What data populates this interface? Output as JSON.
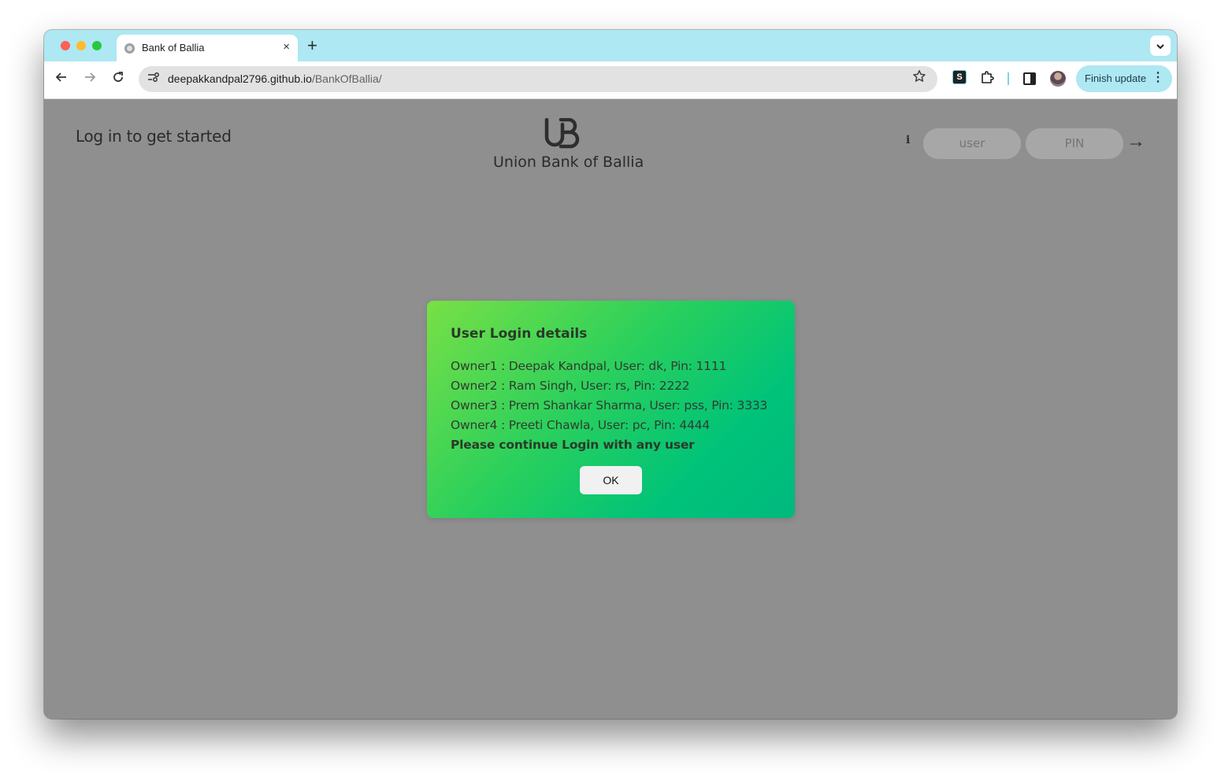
{
  "browser": {
    "tab_title": "Bank of Ballia",
    "tab_close_icon": "×",
    "new_tab_icon": "+",
    "url_host": "deepakkandpal2796.github.io",
    "url_path": "/BankOfBallia/",
    "finish_update_label": "Finish update",
    "extension_s_label": "S"
  },
  "header": {
    "welcome": "Log in to get started",
    "bank_name": "Union Bank of Ballia",
    "info_icon": "i",
    "user_placeholder": "user",
    "pin_placeholder": "PIN",
    "login_arrow": "→"
  },
  "modal": {
    "title": "User Login details",
    "lines": [
      "Owner1 : Deepak Kandpal, User: dk, Pin: 1111",
      "Owner2 : Ram Singh, User: rs, Pin: 2222",
      "Owner3 : Prem Shankar Sharma, User: pss, Pin: 3333",
      "Owner4 : Preeti Chawla, User: pc, Pin: 4444"
    ],
    "cta": "Please continue Login with any user",
    "ok_label": "OK"
  },
  "colors": {
    "page_overlay": "#8f8f8f",
    "modal_gradient_start": "#78e045",
    "modal_gradient_end": "#00b87f",
    "tabstrip": "#ade8f3"
  }
}
